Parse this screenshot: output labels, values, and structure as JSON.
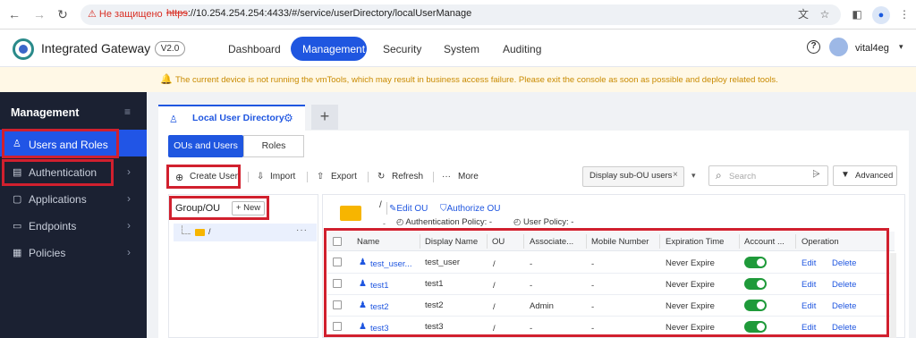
{
  "browser": {
    "insecure_label": "Не защищено",
    "url_scheme": "https",
    "url_rest": "://10.254.254.254:4433/#/service/userDirectory/localUserManage"
  },
  "app": {
    "name": "Integrated Gateway",
    "version": "V2.0",
    "nav": [
      "Dashboard",
      "Management",
      "Security",
      "System",
      "Auditing"
    ],
    "active_nav": "Management",
    "username": "vital4eg"
  },
  "notice": "The current device is not running the vmTools, which may result in business access failure. Please exit the console as soon as possible and deploy related tools.",
  "sidebar": {
    "title": "Management",
    "items": [
      {
        "label": "Users and Roles",
        "icon": "user-icon",
        "active": true
      },
      {
        "label": "Authentication",
        "icon": "doc-icon"
      },
      {
        "label": "Applications",
        "icon": "app-icon"
      },
      {
        "label": "Endpoints",
        "icon": "endpoint-icon"
      },
      {
        "label": "Policies",
        "icon": "policy-icon"
      }
    ]
  },
  "tab": {
    "label": "Local User Directory",
    "add": "+"
  },
  "segments": [
    "OUs and Users",
    "Roles"
  ],
  "toolbar": {
    "create_user": "Create User",
    "import": "Import",
    "export": "Export",
    "refresh": "Refresh",
    "more": "More",
    "suboU_filter": "Display sub-OU users",
    "search_placeholder": "Search",
    "advanced": "Advanced"
  },
  "tree": {
    "title": "Group/OU",
    "new_label": "+ New",
    "root": "/"
  },
  "ou": {
    "path": "/",
    "edit": "Edit OU",
    "authorize": "Authorize OU",
    "dash": "-",
    "auth_policy": "Authentication Policy: -",
    "user_policy": "User Policy: -"
  },
  "table": {
    "columns": [
      "Name",
      "Display Name",
      "OU",
      "Associate...",
      "Mobile Number",
      "Expiration Time",
      "Account ...",
      "Operation"
    ],
    "rows": [
      {
        "name": "test_user...",
        "display": "test_user",
        "ou": "/",
        "assoc": "-",
        "mobile": "-",
        "expire": "Never Expire",
        "edit": "Edit",
        "delete": "Delete"
      },
      {
        "name": "test1",
        "display": "test1",
        "ou": "/",
        "assoc": "-",
        "mobile": "-",
        "expire": "Never Expire",
        "edit": "Edit",
        "delete": "Delete"
      },
      {
        "name": "test2",
        "display": "test2",
        "ou": "/",
        "assoc": "Admin",
        "mobile": "-",
        "expire": "Never Expire",
        "edit": "Edit",
        "delete": "Delete"
      },
      {
        "name": "test3",
        "display": "test3",
        "ou": "/",
        "assoc": "-",
        "mobile": "-",
        "expire": "Never Expire",
        "edit": "Edit",
        "delete": "Delete"
      }
    ]
  },
  "colors": {
    "accent": "#1f56e0",
    "highlight": "#d1202e",
    "toggle_on": "#1f9a3a"
  }
}
